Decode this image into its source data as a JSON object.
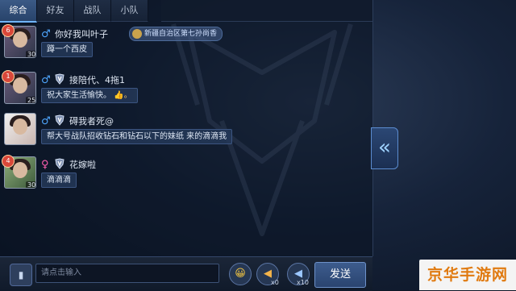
{
  "tabs": [
    {
      "label": "综合",
      "active": true
    },
    {
      "label": "好友",
      "active": false
    },
    {
      "label": "战队",
      "active": false
    },
    {
      "label": "小队",
      "active": false
    }
  ],
  "messages": [
    {
      "rank": "6",
      "level": "30",
      "gender": "male",
      "name": "你好我叫叶子",
      "tag": "新疆自治区第七孙尚香",
      "text": "蹲一个西皮"
    },
    {
      "rank": "1",
      "level": "25",
      "gender": "male",
      "name": "接陪代、4拖1",
      "text": "祝大家生活愉快。",
      "emoji": "👍。"
    },
    {
      "rank": "",
      "level": "",
      "gender": "male",
      "name": "碍我者死@",
      "text": "帮大号战队招收钻石和钻石以下的妹纸 来的滴滴我"
    },
    {
      "rank": "4",
      "level": "30",
      "gender": "female",
      "name": "花嫁啦",
      "text": "滴滴滴"
    }
  ],
  "gender_symbols": {
    "male": "♂",
    "female": "♀"
  },
  "input": {
    "placeholder": "请点击输入"
  },
  "buttons": {
    "send": "发送",
    "emoji_icon": "😀",
    "horn_small_count": "x0",
    "horn_big_count": "x10"
  },
  "watermark": "京华手游网",
  "colors": {
    "male": "#4fa7ff",
    "female": "#ff5fb0",
    "active_tab": "#6fb4ff"
  }
}
